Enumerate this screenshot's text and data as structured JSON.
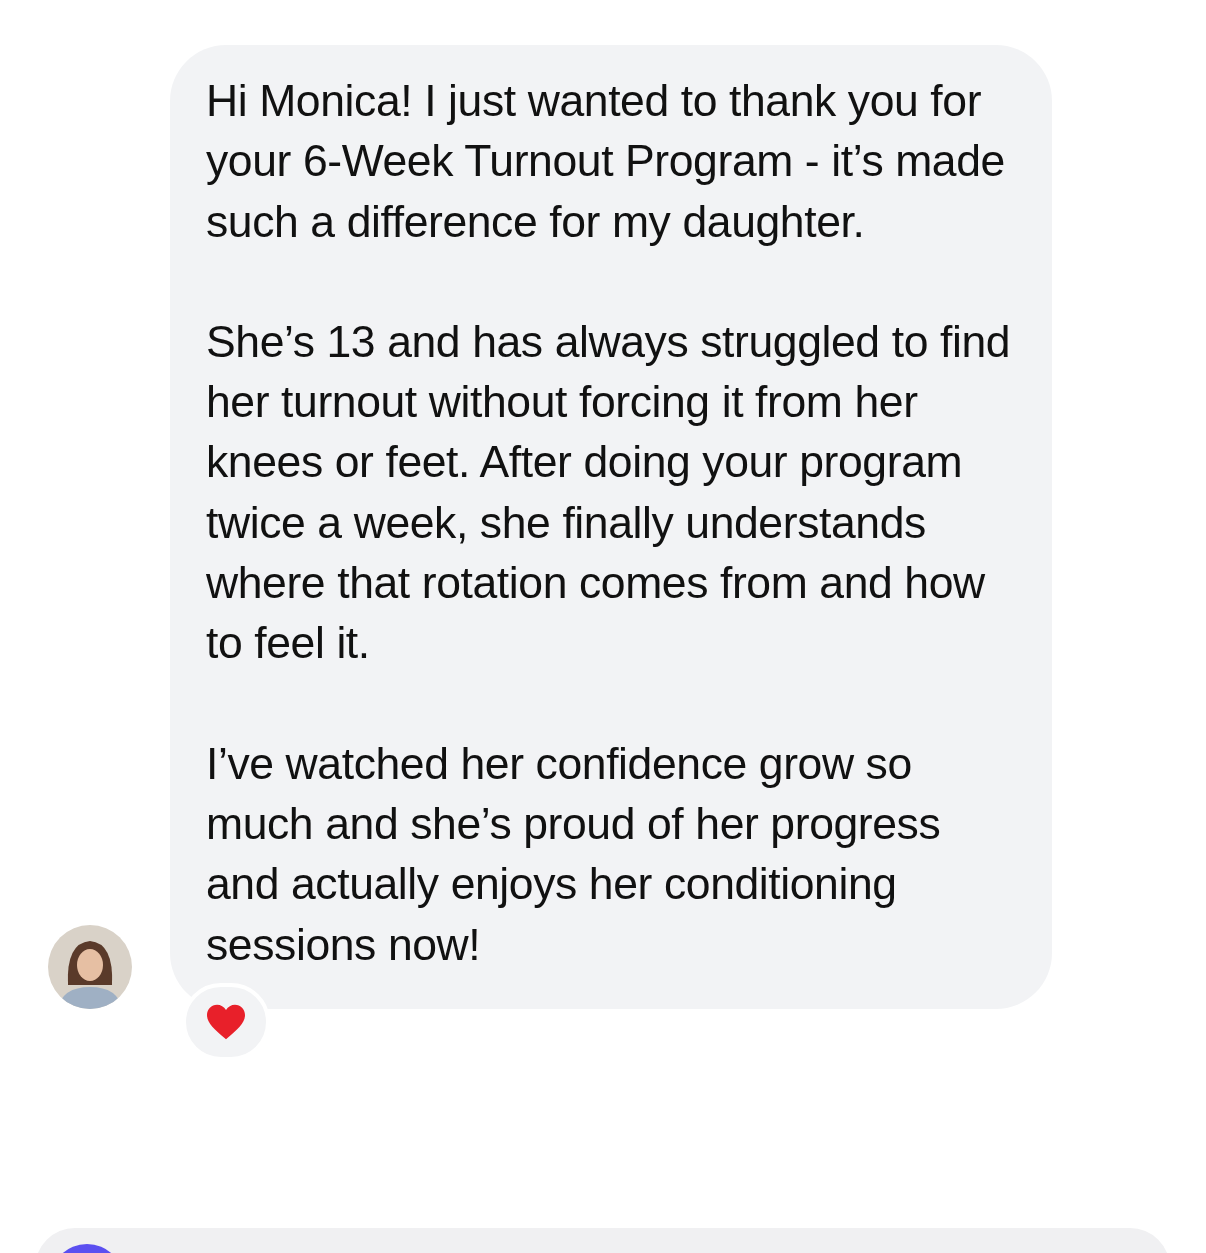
{
  "message": {
    "paragraphs": [
      "Hi Monica! I just wanted to thank you for your 6-Week Turnout Program - it’s made such a difference for my daughter.",
      "She’s 13 and has always struggled to find her turnout without forcing it from her knees or feet. After doing your program twice a week, she finally understands where that rotation comes from and how to feel it.",
      "I’ve watched her confidence grow so much and she’s proud of her progress and actually enjoys her conditioning sessions now!"
    ],
    "reaction": {
      "kind": "heart"
    }
  }
}
